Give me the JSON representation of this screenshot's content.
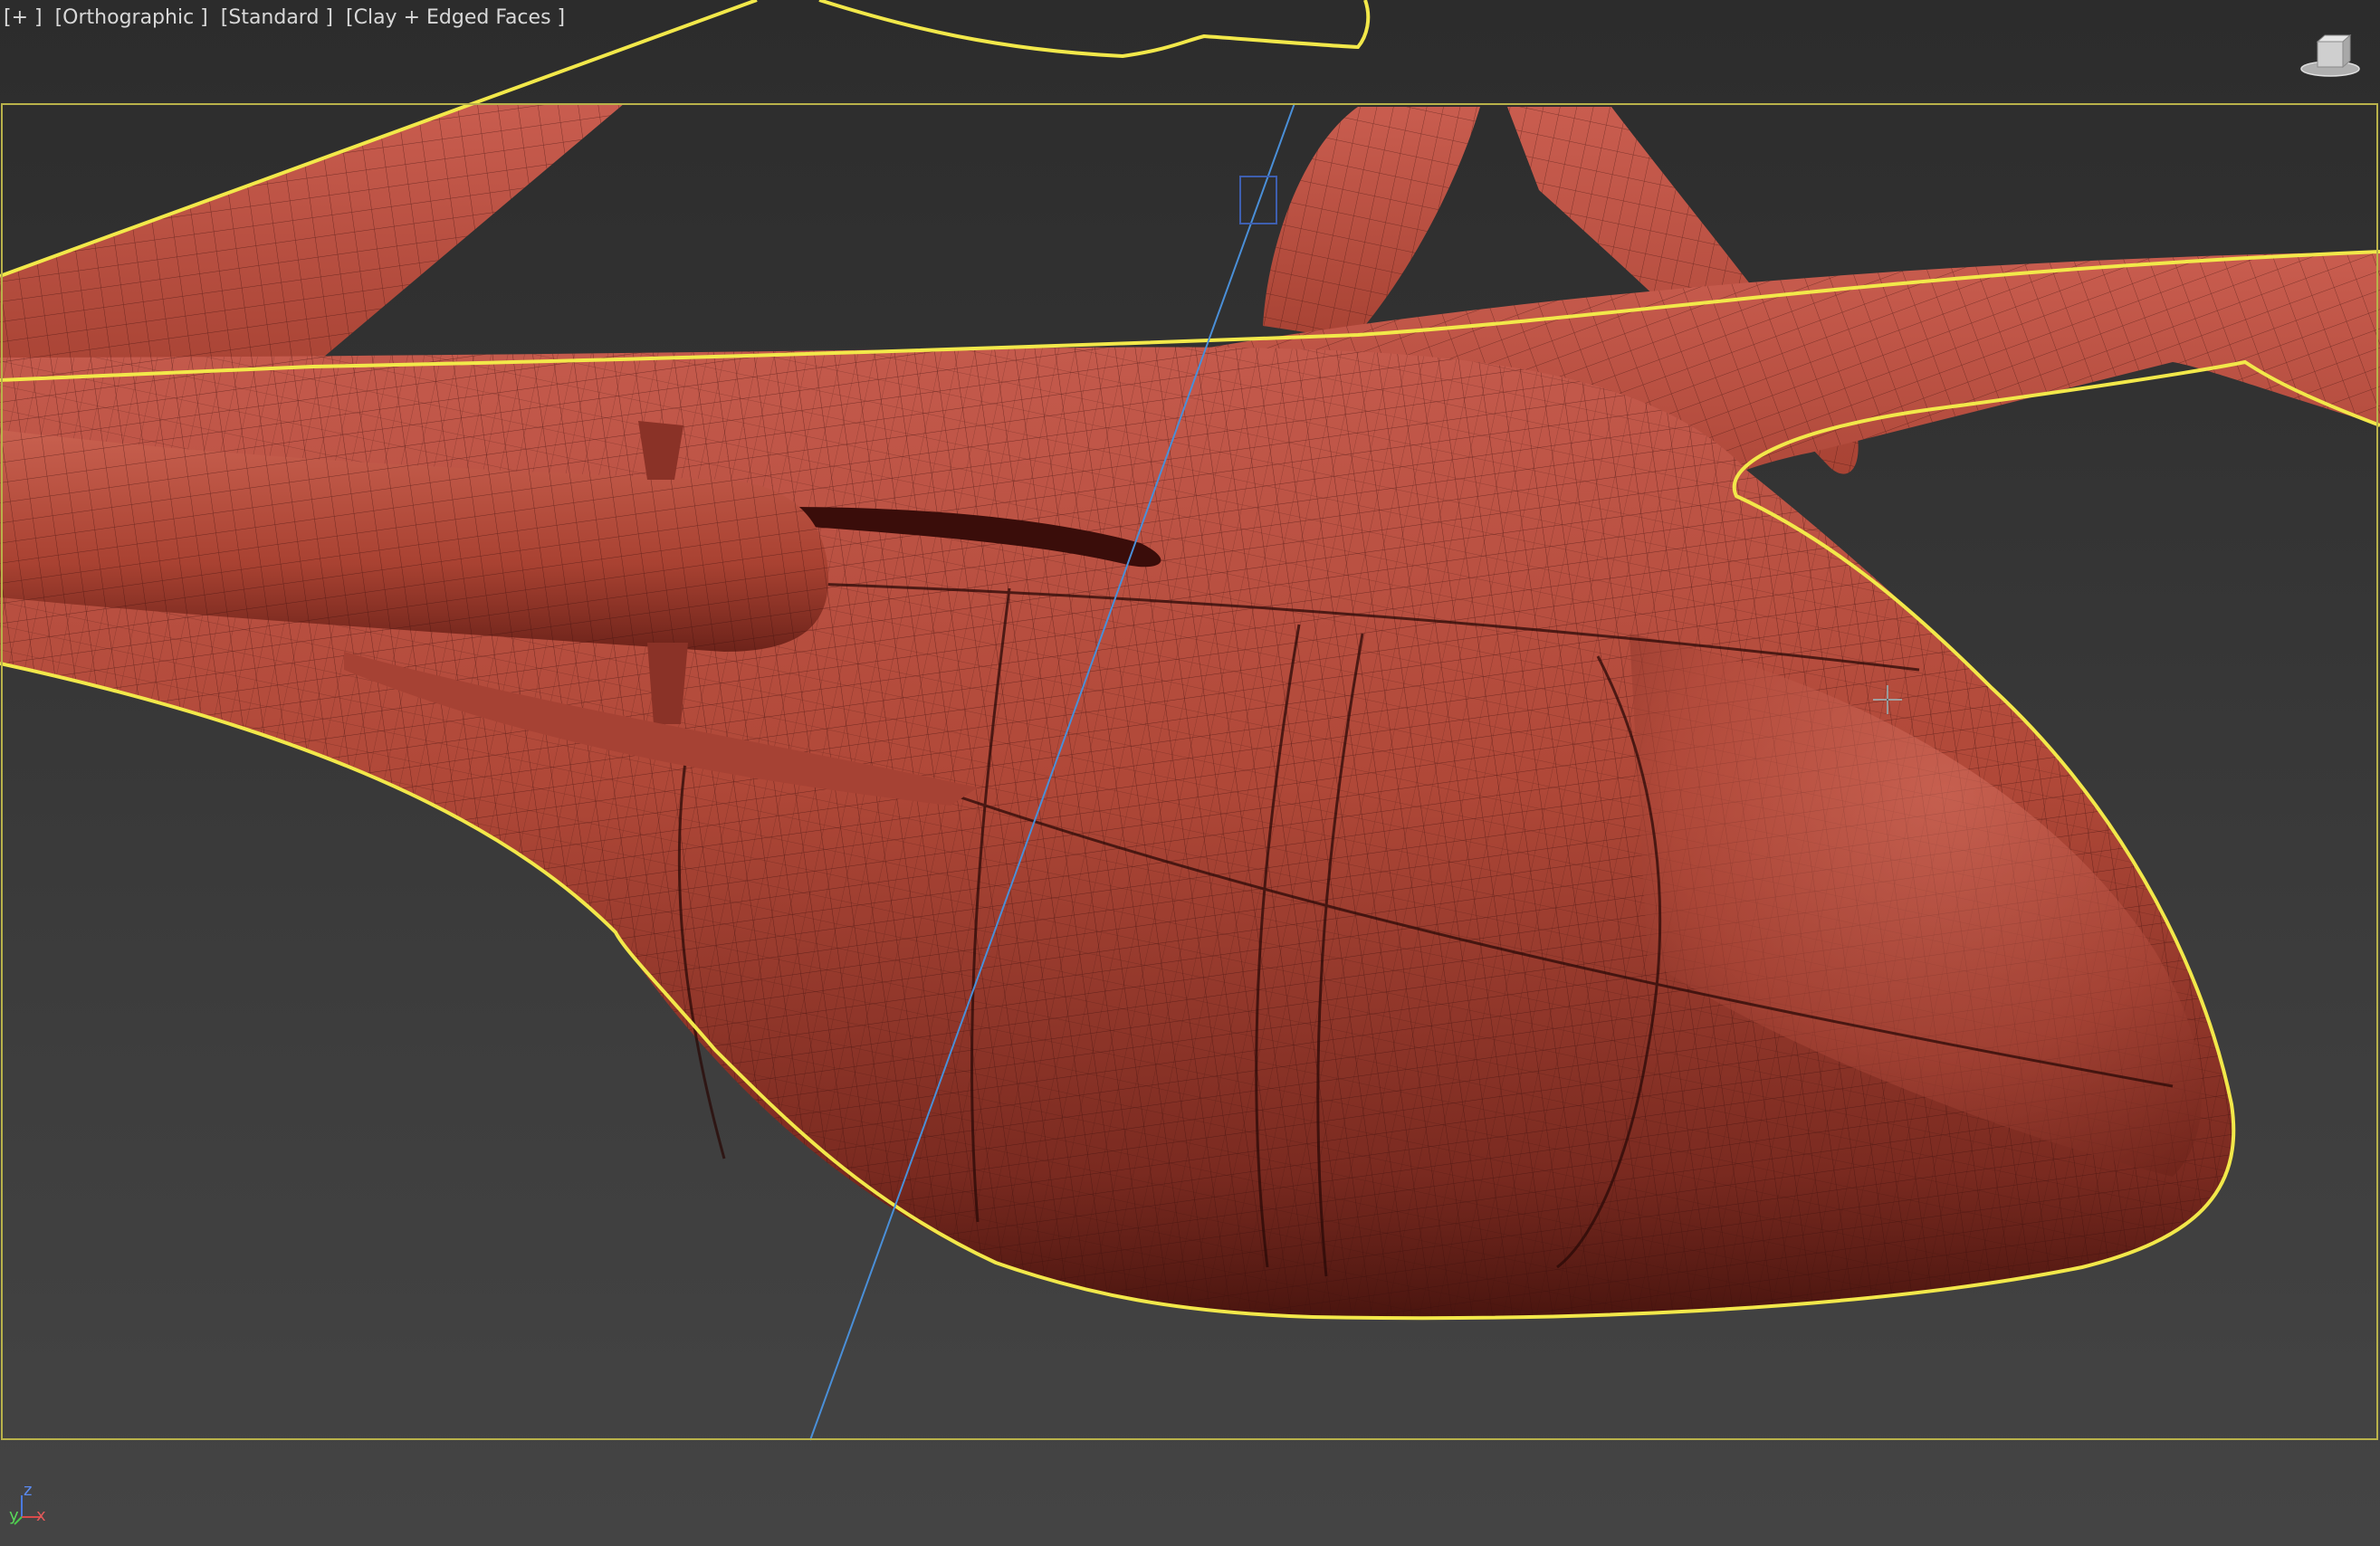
{
  "viewport": {
    "menu_label": "[+ ]",
    "view_label": "[Orthographic ]",
    "shading_preset_label": "[Standard ]",
    "display_mode_label": "[Clay + Edged Faces ]"
  },
  "axis_tripod": {
    "x": "x",
    "y": "y",
    "z": "z"
  },
  "colors": {
    "model": "#b54a3e",
    "selection_outline": "#f2e84a",
    "safe_frame": "#b9b24a",
    "background_top": "#2c2c2c",
    "background_bottom": "#444444",
    "gizmo_line": "#4a8fd8"
  },
  "icons": {
    "viewcube": "viewcube-icon",
    "cursor": "move-cursor-icon",
    "axis": "axis-tripod-icon"
  }
}
